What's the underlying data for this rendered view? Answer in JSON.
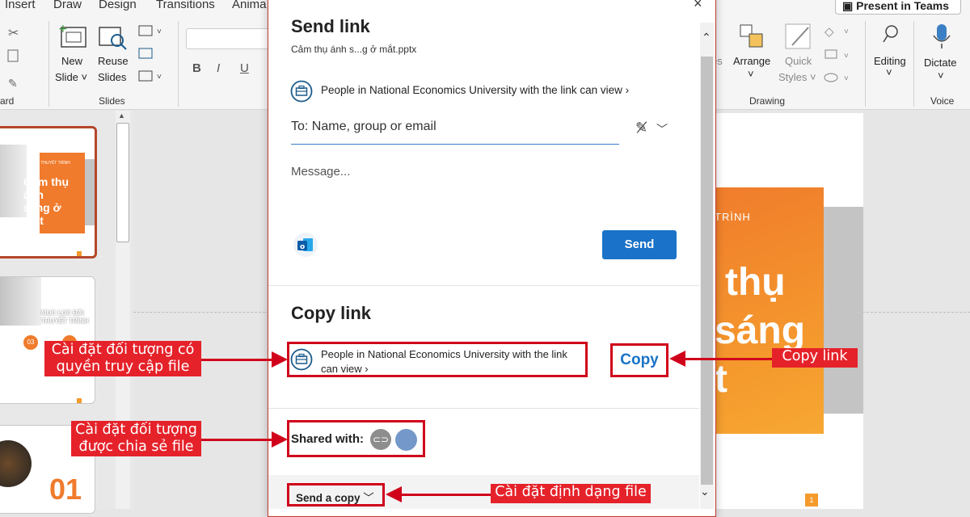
{
  "ribbon": {
    "tabs": [
      "Insert",
      "Draw",
      "Design",
      "Transitions",
      "Anima"
    ],
    "present_btn": "Present in Teams",
    "new_slide": "New",
    "new_slide2": "Slide ˅",
    "reuse": "Reuse",
    "reuse2": "Slides",
    "slides_group": "Slides",
    "clipboard_group": "ard",
    "arrange": "Arrange",
    "quick_styles": "Quick",
    "quick_styles2": "Styles ˅",
    "drawing_group": "Drawing",
    "editing": "Editing",
    "dictate": "Dictate",
    "voice_group": "Voice",
    "shapes_partial": "es",
    "bold": "B",
    "italic": "I",
    "underline": "U"
  },
  "thumbs": {
    "slide1_small": "BÀI THUYẾT TRÌNH",
    "slide1_title": "Cảm thụ ánh sáng ở mắt",
    "slide2_title": "MỤC LỤC BÀI THUYẾT TRÌNH",
    "slide2_num": "03",
    "slide3_num": "01"
  },
  "slide": {
    "top_text": "TRÌNH",
    "line1": "thụ",
    "line2": "sáng",
    "line3": "t",
    "number": "1"
  },
  "dialog": {
    "title": "Send link",
    "filename": "Cảm thụ ánh s...g ở mắt.pptx",
    "permission": "People in National Economics University with the link can view ›",
    "to_placeholder": "To: Name, group or email",
    "message_placeholder": "Message...",
    "send": "Send",
    "copy_title": "Copy link",
    "copy_perm_line1": "People in National Economics University with the link",
    "copy_perm_line2": "can view ›",
    "copy": "Copy",
    "shared_with": "Shared with:",
    "send_copy": "Send a copy"
  },
  "annotations": {
    "access": "Cài đặt đối tượng có quyền truy cập file",
    "shared": "Cài đặt đối tượng được chia sẻ file",
    "copy_link": "Copy link",
    "format": "Cài đặt định dạng file"
  },
  "colors": {
    "accent_red": "#d0021b",
    "link_blue": "#1a73c8",
    "slide_orange": "#f59a2d"
  }
}
